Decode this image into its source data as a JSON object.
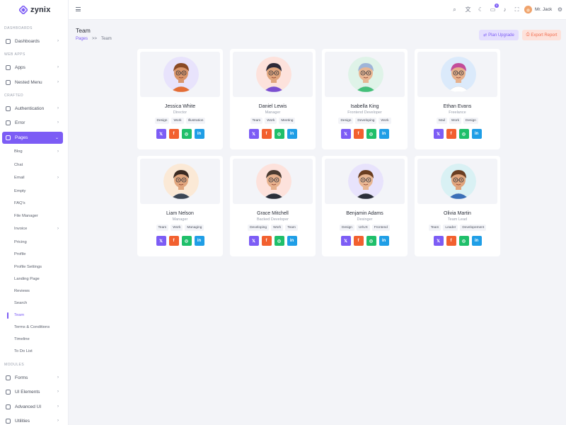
{
  "app": {
    "name": "zynix",
    "brand_color": "#7c5cf5"
  },
  "sidebar": {
    "sections": {
      "dashboards": "DASHBOARDS",
      "web_apps": "WEB APPS",
      "crafted": "CRAFTED",
      "modules": "MODULES"
    },
    "items": {
      "dashboards": "Dashboards",
      "apps": "Apps",
      "nested_menu": "Nested Menu",
      "authentication": "Authentication",
      "error": "Error",
      "pages": "Pages",
      "forms": "Forms",
      "ui_elements": "UI Elements",
      "advanced_ui": "Advanced UI",
      "utilities": "Utilities"
    },
    "pages_sub": [
      "Blog",
      "Chat",
      "Email",
      "Empty",
      "FAQ's",
      "File Manager",
      "Invoice",
      "Pricing",
      "Profile",
      "Profile Settings",
      "Landing Page",
      "Reviews",
      "Search",
      "Team",
      "Terms & Conditions",
      "Timeline",
      "To Do List"
    ]
  },
  "header": {
    "icons": [
      "search-icon",
      "translate-icon",
      "moon-icon",
      "cart-icon",
      "bell-icon",
      "fullscreen-icon",
      "gear-icon"
    ],
    "cart_badge": "5",
    "user_name": "Mr. Jack"
  },
  "page": {
    "title": "Team",
    "breadcrumb": {
      "root": "Pages",
      "separator": ">>",
      "current": "Team"
    },
    "upgrade_label": "Plan Upgrade",
    "export_label": "Export Report"
  },
  "members": [
    {
      "name": "Jessica White",
      "role": "Director",
      "tags": [
        "Design",
        "Work",
        "Illustration"
      ],
      "bg": "#e8e3fc",
      "skin": "#d9956b",
      "hair": "#8a4a25",
      "shirt": "#e46d36"
    },
    {
      "name": "Daniel Lewis",
      "role": "Manager",
      "tags": [
        "Team",
        "Work",
        "Meeting"
      ],
      "bg": "#fde2dc",
      "skin": "#e0a57d",
      "hair": "#2d2a38",
      "shirt": "#7b4fd1"
    },
    {
      "name": "Isabella King",
      "role": "Frontend Developer",
      "tags": [
        "Design",
        "Developing",
        "Work"
      ],
      "bg": "#dff3e8",
      "skin": "#e8b693",
      "hair": "#9fb5d8",
      "shirt": "#45c07a"
    },
    {
      "name": "Ethan Evans",
      "role": "Freelance",
      "tags": [
        "Mail",
        "Work",
        "Design"
      ],
      "bg": "#dbeafb",
      "skin": "#e6b08c",
      "hair": "#c34d9a",
      "shirt": "#ffffff"
    },
    {
      "name": "Liam Nelson",
      "role": "Manager",
      "tags": [
        "Team",
        "Work",
        "Managing"
      ],
      "bg": "#fbe9d6",
      "skin": "#e0a57d",
      "hair": "#3a2a22",
      "shirt": "#3c4654"
    },
    {
      "name": "Grace Mitchell",
      "role": "Backed Developer",
      "tags": [
        "Developing",
        "Work",
        "Team"
      ],
      "bg": "#fde2dc",
      "skin": "#e6b08c",
      "hair": "#4a3a30",
      "shirt": "#2b2f3a"
    },
    {
      "name": "Benjamin Adams",
      "role": "Desinger",
      "tags": [
        "Design",
        "UI/UX",
        "Frontend"
      ],
      "bg": "#e8e3fc",
      "skin": "#e8b693",
      "hair": "#6a3e22",
      "shirt": "#2b2f3a"
    },
    {
      "name": "Olivia Martin",
      "role": "Team Lead",
      "tags": [
        "Team",
        "Leader",
        "Developement"
      ],
      "bg": "#d9f1f4",
      "skin": "#e0a57d",
      "hair": "#6a3e22",
      "shirt": "#3a6fb8"
    }
  ],
  "social": [
    "𝕏",
    "f",
    "◎",
    "in"
  ]
}
